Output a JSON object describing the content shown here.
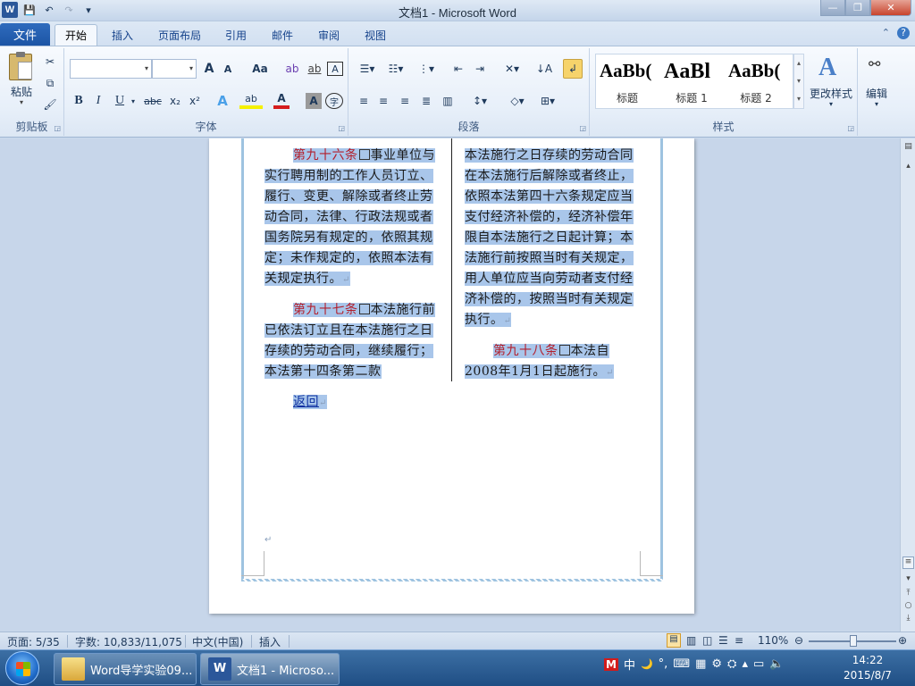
{
  "window": {
    "title": "文档1 - Microsoft Word"
  },
  "qat": {
    "logo": "W",
    "save": "💾",
    "undo": "↶",
    "redo": "↷",
    "customize": "▾"
  },
  "window_controls": {
    "minimize": "—",
    "maximize": "❐",
    "close": "✕"
  },
  "tabs": {
    "file": "文件",
    "items": [
      {
        "label": "开始",
        "active": true
      },
      {
        "label": "插入"
      },
      {
        "label": "页面布局"
      },
      {
        "label": "引用"
      },
      {
        "label": "邮件"
      },
      {
        "label": "审阅"
      },
      {
        "label": "视图"
      }
    ],
    "help": "?",
    "collapse": "⌃"
  },
  "ribbon": {
    "clipboard": {
      "label": "剪贴板",
      "paste": "粘贴"
    },
    "font": {
      "label": "字体",
      "font_name": "",
      "font_size": "",
      "grow": "A",
      "shrink": "A",
      "case": "Aa",
      "clear": "A",
      "bold": "B",
      "italic": "I",
      "underline": "U",
      "strike": "abc",
      "sub": "x₂",
      "sup": "x²",
      "effects": "A",
      "highlight": "ab",
      "color": "A",
      "char_shade": "A",
      "enclose": "字"
    },
    "paragraph": {
      "label": "段落"
    },
    "styles": {
      "label": "样式",
      "items": [
        {
          "preview": "AaBb(",
          "name": "标题"
        },
        {
          "preview": "AaBl",
          "name": "标题 1"
        },
        {
          "preview": "AaBb(",
          "name": "标题 2"
        }
      ],
      "change_styles": "更改样式"
    },
    "editing": {
      "label": "编辑"
    }
  },
  "document": {
    "left_col": [
      {
        "article": "第九十六条",
        "text": "事业单位与实行聘用制的工作人员订立、履行、变更、解除或者终止劳动合同，法律、行政法规或者国务院另有规定的，依照其规定；未作规定的，依照本法有关规定执行。"
      },
      {
        "article": "第九十七条",
        "text": "本法施行前已依法订立且在本法施行之日存续的劳动合同，继续履行；本法第十四条第二款"
      }
    ],
    "right_col": [
      {
        "article": "",
        "text": "本法施行之日存续的劳动合同在本法施行后解除或者终止，依照本法第四十六条规定应当支付经济补偿的，经济补偿年限自本法施行之日起计算；本法施行前按照当时有关规定，用人单位应当向劳动者支付经济补偿的，按照当时有关规定执行。"
      },
      {
        "article": "第九十八条",
        "text": "本法自2008年1月1日起施行。"
      }
    ],
    "back_link": "返回",
    "para_mark": "↵"
  },
  "status": {
    "page": "页面: 5/35",
    "words": "字数: 10,833/11,075",
    "language": "中文(中国)",
    "mode": "插入",
    "zoom": "110%"
  },
  "taskbar": {
    "items": [
      {
        "label": "Word导学实验09...",
        "active": false
      },
      {
        "label": "文档1 - Microso...",
        "active": true
      }
    ],
    "tray": {
      "ime": "中",
      "moon": "🌙",
      "deg": "°,"
    },
    "time": "14:22",
    "date": "2015/8/7"
  }
}
